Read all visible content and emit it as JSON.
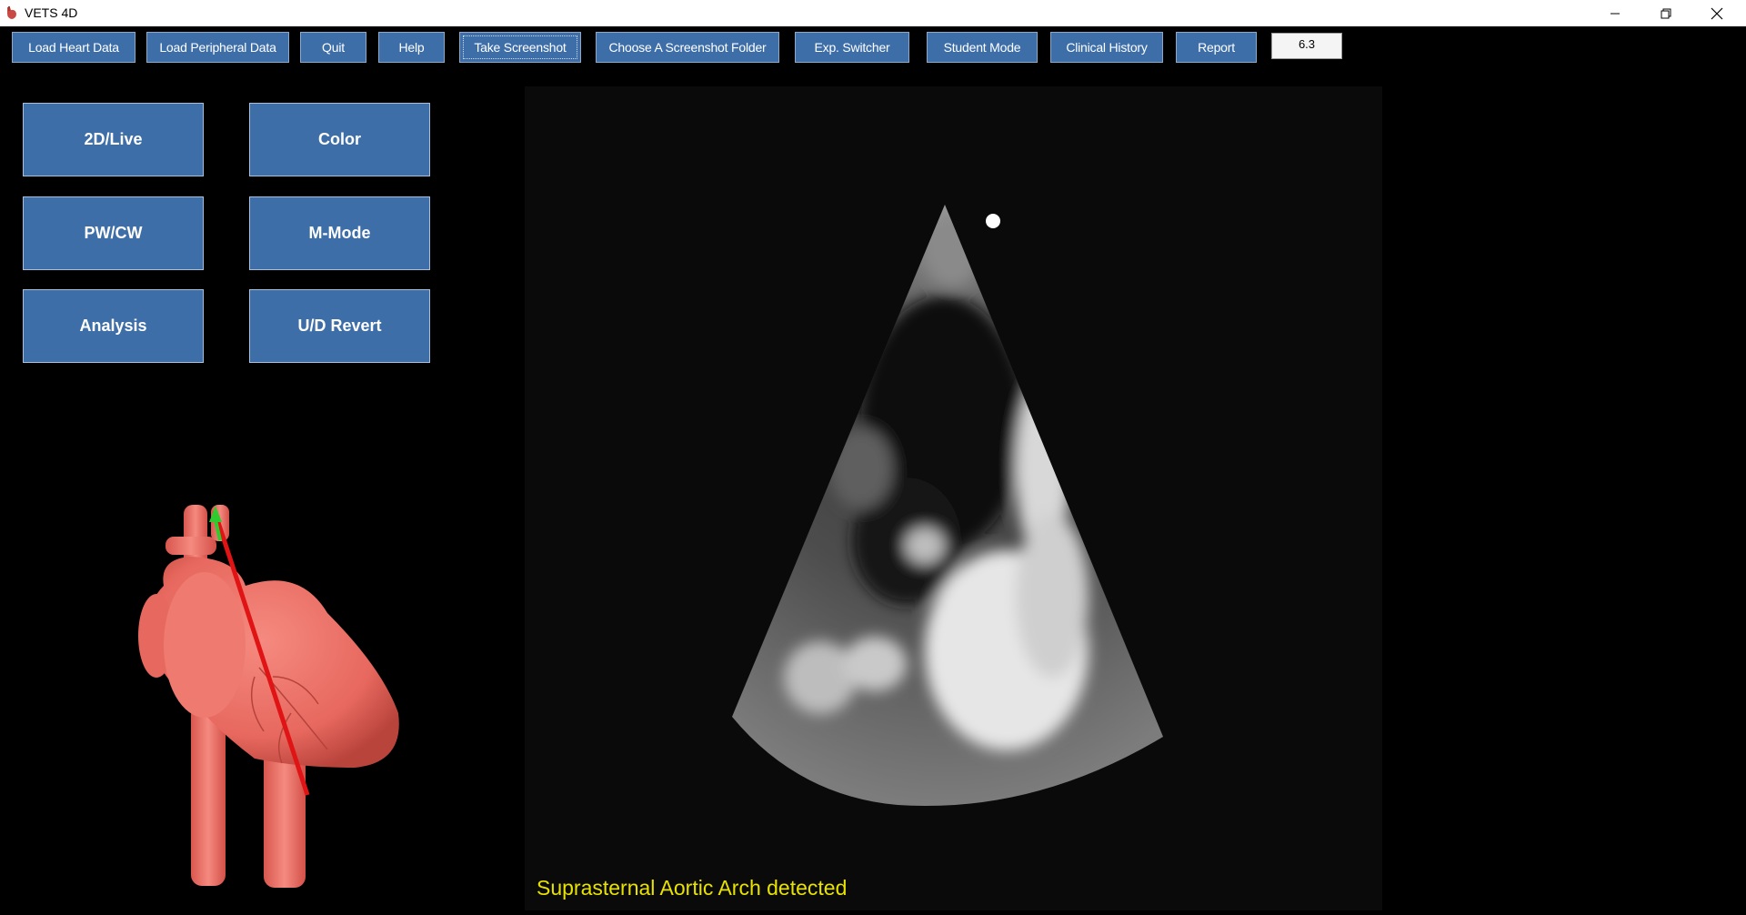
{
  "window": {
    "title": "VETS 4D",
    "controls": [
      "minimize",
      "restore",
      "close"
    ]
  },
  "toolbar": {
    "buttons": [
      {
        "label": "Load Heart Data"
      },
      {
        "label": "Load Peripheral Data"
      },
      {
        "label": "Quit"
      },
      {
        "label": "Help"
      },
      {
        "label": "Take Screenshot"
      },
      {
        "label": "Choose A Screenshot Folder"
      },
      {
        "label": "Exp. Switcher"
      },
      {
        "label": "Student Mode"
      },
      {
        "label": "Clinical History"
      },
      {
        "label": "Report"
      }
    ],
    "version": "6.3"
  },
  "modes": {
    "buttons": [
      {
        "label": "2D/Live"
      },
      {
        "label": "Color"
      },
      {
        "label": "PW/CW"
      },
      {
        "label": "M-Mode"
      },
      {
        "label": "Analysis"
      },
      {
        "label": "U/D Revert"
      }
    ]
  },
  "icons": {
    "app": "heart-app-icon",
    "minimize": "minimize-icon",
    "restore": "restore-icon",
    "close": "close-icon"
  },
  "colors": {
    "button_bg": "#3d6ea8",
    "status_text": "#e8e200",
    "heart": "#f07e74",
    "probe_line": "#e01414",
    "probe_arrow": "#2ecc2e"
  },
  "status": {
    "message": "Suprasternal Aortic Arch detected"
  }
}
